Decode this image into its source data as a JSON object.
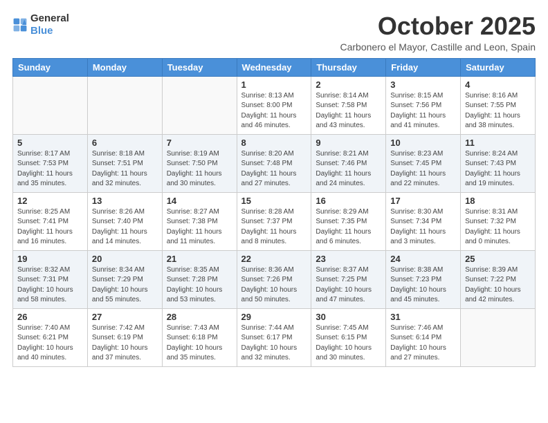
{
  "logo": {
    "general": "General",
    "blue": "Blue"
  },
  "title": "October 2025",
  "subtitle": "Carbonero el Mayor, Castille and Leon, Spain",
  "days_of_week": [
    "Sunday",
    "Monday",
    "Tuesday",
    "Wednesday",
    "Thursday",
    "Friday",
    "Saturday"
  ],
  "weeks": [
    [
      {
        "day": "",
        "info": ""
      },
      {
        "day": "",
        "info": ""
      },
      {
        "day": "",
        "info": ""
      },
      {
        "day": "1",
        "info": "Sunrise: 8:13 AM\nSunset: 8:00 PM\nDaylight: 11 hours and 46 minutes."
      },
      {
        "day": "2",
        "info": "Sunrise: 8:14 AM\nSunset: 7:58 PM\nDaylight: 11 hours and 43 minutes."
      },
      {
        "day": "3",
        "info": "Sunrise: 8:15 AM\nSunset: 7:56 PM\nDaylight: 11 hours and 41 minutes."
      },
      {
        "day": "4",
        "info": "Sunrise: 8:16 AM\nSunset: 7:55 PM\nDaylight: 11 hours and 38 minutes."
      }
    ],
    [
      {
        "day": "5",
        "info": "Sunrise: 8:17 AM\nSunset: 7:53 PM\nDaylight: 11 hours and 35 minutes."
      },
      {
        "day": "6",
        "info": "Sunrise: 8:18 AM\nSunset: 7:51 PM\nDaylight: 11 hours and 32 minutes."
      },
      {
        "day": "7",
        "info": "Sunrise: 8:19 AM\nSunset: 7:50 PM\nDaylight: 11 hours and 30 minutes."
      },
      {
        "day": "8",
        "info": "Sunrise: 8:20 AM\nSunset: 7:48 PM\nDaylight: 11 hours and 27 minutes."
      },
      {
        "day": "9",
        "info": "Sunrise: 8:21 AM\nSunset: 7:46 PM\nDaylight: 11 hours and 24 minutes."
      },
      {
        "day": "10",
        "info": "Sunrise: 8:23 AM\nSunset: 7:45 PM\nDaylight: 11 hours and 22 minutes."
      },
      {
        "day": "11",
        "info": "Sunrise: 8:24 AM\nSunset: 7:43 PM\nDaylight: 11 hours and 19 minutes."
      }
    ],
    [
      {
        "day": "12",
        "info": "Sunrise: 8:25 AM\nSunset: 7:41 PM\nDaylight: 11 hours and 16 minutes."
      },
      {
        "day": "13",
        "info": "Sunrise: 8:26 AM\nSunset: 7:40 PM\nDaylight: 11 hours and 14 minutes."
      },
      {
        "day": "14",
        "info": "Sunrise: 8:27 AM\nSunset: 7:38 PM\nDaylight: 11 hours and 11 minutes."
      },
      {
        "day": "15",
        "info": "Sunrise: 8:28 AM\nSunset: 7:37 PM\nDaylight: 11 hours and 8 minutes."
      },
      {
        "day": "16",
        "info": "Sunrise: 8:29 AM\nSunset: 7:35 PM\nDaylight: 11 hours and 6 minutes."
      },
      {
        "day": "17",
        "info": "Sunrise: 8:30 AM\nSunset: 7:34 PM\nDaylight: 11 hours and 3 minutes."
      },
      {
        "day": "18",
        "info": "Sunrise: 8:31 AM\nSunset: 7:32 PM\nDaylight: 11 hours and 0 minutes."
      }
    ],
    [
      {
        "day": "19",
        "info": "Sunrise: 8:32 AM\nSunset: 7:31 PM\nDaylight: 10 hours and 58 minutes."
      },
      {
        "day": "20",
        "info": "Sunrise: 8:34 AM\nSunset: 7:29 PM\nDaylight: 10 hours and 55 minutes."
      },
      {
        "day": "21",
        "info": "Sunrise: 8:35 AM\nSunset: 7:28 PM\nDaylight: 10 hours and 53 minutes."
      },
      {
        "day": "22",
        "info": "Sunrise: 8:36 AM\nSunset: 7:26 PM\nDaylight: 10 hours and 50 minutes."
      },
      {
        "day": "23",
        "info": "Sunrise: 8:37 AM\nSunset: 7:25 PM\nDaylight: 10 hours and 47 minutes."
      },
      {
        "day": "24",
        "info": "Sunrise: 8:38 AM\nSunset: 7:23 PM\nDaylight: 10 hours and 45 minutes."
      },
      {
        "day": "25",
        "info": "Sunrise: 8:39 AM\nSunset: 7:22 PM\nDaylight: 10 hours and 42 minutes."
      }
    ],
    [
      {
        "day": "26",
        "info": "Sunrise: 7:40 AM\nSunset: 6:21 PM\nDaylight: 10 hours and 40 minutes."
      },
      {
        "day": "27",
        "info": "Sunrise: 7:42 AM\nSunset: 6:19 PM\nDaylight: 10 hours and 37 minutes."
      },
      {
        "day": "28",
        "info": "Sunrise: 7:43 AM\nSunset: 6:18 PM\nDaylight: 10 hours and 35 minutes."
      },
      {
        "day": "29",
        "info": "Sunrise: 7:44 AM\nSunset: 6:17 PM\nDaylight: 10 hours and 32 minutes."
      },
      {
        "day": "30",
        "info": "Sunrise: 7:45 AM\nSunset: 6:15 PM\nDaylight: 10 hours and 30 minutes."
      },
      {
        "day": "31",
        "info": "Sunrise: 7:46 AM\nSunset: 6:14 PM\nDaylight: 10 hours and 27 minutes."
      },
      {
        "day": "",
        "info": ""
      }
    ]
  ]
}
